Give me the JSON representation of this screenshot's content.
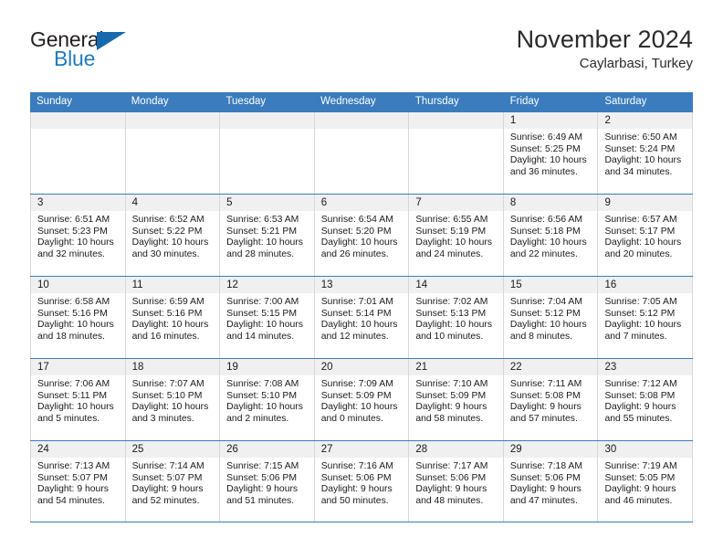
{
  "logo": {
    "word_one": "General",
    "word_two": "Blue",
    "flag_icon": "triangle-flag-icon",
    "brand_color": "#1f7bc1"
  },
  "header": {
    "title": "November 2024",
    "location": "Caylarbasi, Turkey"
  },
  "theme": {
    "header_bg": "#3a7cbd",
    "day_strip_bg": "#f0f0f0",
    "grid_line": "#d7d7d7",
    "text": "#1a1a1a"
  },
  "calendar": {
    "weekdays": [
      "Sunday",
      "Monday",
      "Tuesday",
      "Wednesday",
      "Thursday",
      "Friday",
      "Saturday"
    ],
    "weeks": [
      [
        {
          "date": "",
          "empty": true
        },
        {
          "date": "",
          "empty": true
        },
        {
          "date": "",
          "empty": true
        },
        {
          "date": "",
          "empty": true
        },
        {
          "date": "",
          "empty": true
        },
        {
          "date": "1",
          "sunrise": "Sunrise: 6:49 AM",
          "sunset": "Sunset: 5:25 PM",
          "daylight_line1": "Daylight: 10 hours",
          "daylight_line2": "and 36 minutes."
        },
        {
          "date": "2",
          "sunrise": "Sunrise: 6:50 AM",
          "sunset": "Sunset: 5:24 PM",
          "daylight_line1": "Daylight: 10 hours",
          "daylight_line2": "and 34 minutes."
        }
      ],
      [
        {
          "date": "3",
          "sunrise": "Sunrise: 6:51 AM",
          "sunset": "Sunset: 5:23 PM",
          "daylight_line1": "Daylight: 10 hours",
          "daylight_line2": "and 32 minutes."
        },
        {
          "date": "4",
          "sunrise": "Sunrise: 6:52 AM",
          "sunset": "Sunset: 5:22 PM",
          "daylight_line1": "Daylight: 10 hours",
          "daylight_line2": "and 30 minutes."
        },
        {
          "date": "5",
          "sunrise": "Sunrise: 6:53 AM",
          "sunset": "Sunset: 5:21 PM",
          "daylight_line1": "Daylight: 10 hours",
          "daylight_line2": "and 28 minutes."
        },
        {
          "date": "6",
          "sunrise": "Sunrise: 6:54 AM",
          "sunset": "Sunset: 5:20 PM",
          "daylight_line1": "Daylight: 10 hours",
          "daylight_line2": "and 26 minutes."
        },
        {
          "date": "7",
          "sunrise": "Sunrise: 6:55 AM",
          "sunset": "Sunset: 5:19 PM",
          "daylight_line1": "Daylight: 10 hours",
          "daylight_line2": "and 24 minutes."
        },
        {
          "date": "8",
          "sunrise": "Sunrise: 6:56 AM",
          "sunset": "Sunset: 5:18 PM",
          "daylight_line1": "Daylight: 10 hours",
          "daylight_line2": "and 22 minutes."
        },
        {
          "date": "9",
          "sunrise": "Sunrise: 6:57 AM",
          "sunset": "Sunset: 5:17 PM",
          "daylight_line1": "Daylight: 10 hours",
          "daylight_line2": "and 20 minutes."
        }
      ],
      [
        {
          "date": "10",
          "sunrise": "Sunrise: 6:58 AM",
          "sunset": "Sunset: 5:16 PM",
          "daylight_line1": "Daylight: 10 hours",
          "daylight_line2": "and 18 minutes."
        },
        {
          "date": "11",
          "sunrise": "Sunrise: 6:59 AM",
          "sunset": "Sunset: 5:16 PM",
          "daylight_line1": "Daylight: 10 hours",
          "daylight_line2": "and 16 minutes."
        },
        {
          "date": "12",
          "sunrise": "Sunrise: 7:00 AM",
          "sunset": "Sunset: 5:15 PM",
          "daylight_line1": "Daylight: 10 hours",
          "daylight_line2": "and 14 minutes."
        },
        {
          "date": "13",
          "sunrise": "Sunrise: 7:01 AM",
          "sunset": "Sunset: 5:14 PM",
          "daylight_line1": "Daylight: 10 hours",
          "daylight_line2": "and 12 minutes."
        },
        {
          "date": "14",
          "sunrise": "Sunrise: 7:02 AM",
          "sunset": "Sunset: 5:13 PM",
          "daylight_line1": "Daylight: 10 hours",
          "daylight_line2": "and 10 minutes."
        },
        {
          "date": "15",
          "sunrise": "Sunrise: 7:04 AM",
          "sunset": "Sunset: 5:12 PM",
          "daylight_line1": "Daylight: 10 hours",
          "daylight_line2": "and 8 minutes."
        },
        {
          "date": "16",
          "sunrise": "Sunrise: 7:05 AM",
          "sunset": "Sunset: 5:12 PM",
          "daylight_line1": "Daylight: 10 hours",
          "daylight_line2": "and 7 minutes."
        }
      ],
      [
        {
          "date": "17",
          "sunrise": "Sunrise: 7:06 AM",
          "sunset": "Sunset: 5:11 PM",
          "daylight_line1": "Daylight: 10 hours",
          "daylight_line2": "and 5 minutes."
        },
        {
          "date": "18",
          "sunrise": "Sunrise: 7:07 AM",
          "sunset": "Sunset: 5:10 PM",
          "daylight_line1": "Daylight: 10 hours",
          "daylight_line2": "and 3 minutes."
        },
        {
          "date": "19",
          "sunrise": "Sunrise: 7:08 AM",
          "sunset": "Sunset: 5:10 PM",
          "daylight_line1": "Daylight: 10 hours",
          "daylight_line2": "and 2 minutes."
        },
        {
          "date": "20",
          "sunrise": "Sunrise: 7:09 AM",
          "sunset": "Sunset: 5:09 PM",
          "daylight_line1": "Daylight: 10 hours",
          "daylight_line2": "and 0 minutes."
        },
        {
          "date": "21",
          "sunrise": "Sunrise: 7:10 AM",
          "sunset": "Sunset: 5:09 PM",
          "daylight_line1": "Daylight: 9 hours",
          "daylight_line2": "and 58 minutes."
        },
        {
          "date": "22",
          "sunrise": "Sunrise: 7:11 AM",
          "sunset": "Sunset: 5:08 PM",
          "daylight_line1": "Daylight: 9 hours",
          "daylight_line2": "and 57 minutes."
        },
        {
          "date": "23",
          "sunrise": "Sunrise: 7:12 AM",
          "sunset": "Sunset: 5:08 PM",
          "daylight_line1": "Daylight: 9 hours",
          "daylight_line2": "and 55 minutes."
        }
      ],
      [
        {
          "date": "24",
          "sunrise": "Sunrise: 7:13 AM",
          "sunset": "Sunset: 5:07 PM",
          "daylight_line1": "Daylight: 9 hours",
          "daylight_line2": "and 54 minutes."
        },
        {
          "date": "25",
          "sunrise": "Sunrise: 7:14 AM",
          "sunset": "Sunset: 5:07 PM",
          "daylight_line1": "Daylight: 9 hours",
          "daylight_line2": "and 52 minutes."
        },
        {
          "date": "26",
          "sunrise": "Sunrise: 7:15 AM",
          "sunset": "Sunset: 5:06 PM",
          "daylight_line1": "Daylight: 9 hours",
          "daylight_line2": "and 51 minutes."
        },
        {
          "date": "27",
          "sunrise": "Sunrise: 7:16 AM",
          "sunset": "Sunset: 5:06 PM",
          "daylight_line1": "Daylight: 9 hours",
          "daylight_line2": "and 50 minutes."
        },
        {
          "date": "28",
          "sunrise": "Sunrise: 7:17 AM",
          "sunset": "Sunset: 5:06 PM",
          "daylight_line1": "Daylight: 9 hours",
          "daylight_line2": "and 48 minutes."
        },
        {
          "date": "29",
          "sunrise": "Sunrise: 7:18 AM",
          "sunset": "Sunset: 5:06 PM",
          "daylight_line1": "Daylight: 9 hours",
          "daylight_line2": "and 47 minutes."
        },
        {
          "date": "30",
          "sunrise": "Sunrise: 7:19 AM",
          "sunset": "Sunset: 5:05 PM",
          "daylight_line1": "Daylight: 9 hours",
          "daylight_line2": "and 46 minutes."
        }
      ]
    ]
  }
}
